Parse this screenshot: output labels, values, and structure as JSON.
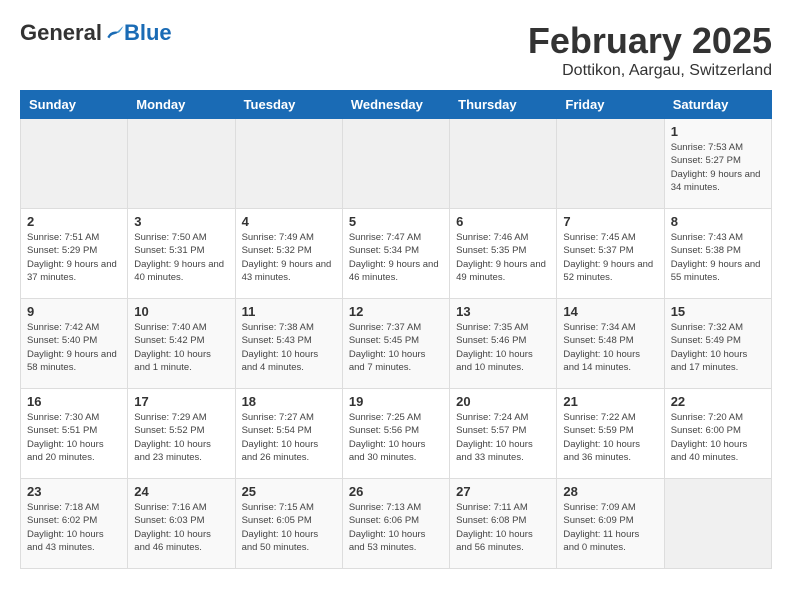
{
  "header": {
    "logo_general": "General",
    "logo_blue": "Blue",
    "month_year": "February 2025",
    "location": "Dottikon, Aargau, Switzerland"
  },
  "days_of_week": [
    "Sunday",
    "Monday",
    "Tuesday",
    "Wednesday",
    "Thursday",
    "Friday",
    "Saturday"
  ],
  "weeks": [
    [
      {
        "day": "",
        "info": ""
      },
      {
        "day": "",
        "info": ""
      },
      {
        "day": "",
        "info": ""
      },
      {
        "day": "",
        "info": ""
      },
      {
        "day": "",
        "info": ""
      },
      {
        "day": "",
        "info": ""
      },
      {
        "day": "1",
        "info": "Sunrise: 7:53 AM\nSunset: 5:27 PM\nDaylight: 9 hours and 34 minutes."
      }
    ],
    [
      {
        "day": "2",
        "info": "Sunrise: 7:51 AM\nSunset: 5:29 PM\nDaylight: 9 hours and 37 minutes."
      },
      {
        "day": "3",
        "info": "Sunrise: 7:50 AM\nSunset: 5:31 PM\nDaylight: 9 hours and 40 minutes."
      },
      {
        "day": "4",
        "info": "Sunrise: 7:49 AM\nSunset: 5:32 PM\nDaylight: 9 hours and 43 minutes."
      },
      {
        "day": "5",
        "info": "Sunrise: 7:47 AM\nSunset: 5:34 PM\nDaylight: 9 hours and 46 minutes."
      },
      {
        "day": "6",
        "info": "Sunrise: 7:46 AM\nSunset: 5:35 PM\nDaylight: 9 hours and 49 minutes."
      },
      {
        "day": "7",
        "info": "Sunrise: 7:45 AM\nSunset: 5:37 PM\nDaylight: 9 hours and 52 minutes."
      },
      {
        "day": "8",
        "info": "Sunrise: 7:43 AM\nSunset: 5:38 PM\nDaylight: 9 hours and 55 minutes."
      }
    ],
    [
      {
        "day": "9",
        "info": "Sunrise: 7:42 AM\nSunset: 5:40 PM\nDaylight: 9 hours and 58 minutes."
      },
      {
        "day": "10",
        "info": "Sunrise: 7:40 AM\nSunset: 5:42 PM\nDaylight: 10 hours and 1 minute."
      },
      {
        "day": "11",
        "info": "Sunrise: 7:38 AM\nSunset: 5:43 PM\nDaylight: 10 hours and 4 minutes."
      },
      {
        "day": "12",
        "info": "Sunrise: 7:37 AM\nSunset: 5:45 PM\nDaylight: 10 hours and 7 minutes."
      },
      {
        "day": "13",
        "info": "Sunrise: 7:35 AM\nSunset: 5:46 PM\nDaylight: 10 hours and 10 minutes."
      },
      {
        "day": "14",
        "info": "Sunrise: 7:34 AM\nSunset: 5:48 PM\nDaylight: 10 hours and 14 minutes."
      },
      {
        "day": "15",
        "info": "Sunrise: 7:32 AM\nSunset: 5:49 PM\nDaylight: 10 hours and 17 minutes."
      }
    ],
    [
      {
        "day": "16",
        "info": "Sunrise: 7:30 AM\nSunset: 5:51 PM\nDaylight: 10 hours and 20 minutes."
      },
      {
        "day": "17",
        "info": "Sunrise: 7:29 AM\nSunset: 5:52 PM\nDaylight: 10 hours and 23 minutes."
      },
      {
        "day": "18",
        "info": "Sunrise: 7:27 AM\nSunset: 5:54 PM\nDaylight: 10 hours and 26 minutes."
      },
      {
        "day": "19",
        "info": "Sunrise: 7:25 AM\nSunset: 5:56 PM\nDaylight: 10 hours and 30 minutes."
      },
      {
        "day": "20",
        "info": "Sunrise: 7:24 AM\nSunset: 5:57 PM\nDaylight: 10 hours and 33 minutes."
      },
      {
        "day": "21",
        "info": "Sunrise: 7:22 AM\nSunset: 5:59 PM\nDaylight: 10 hours and 36 minutes."
      },
      {
        "day": "22",
        "info": "Sunrise: 7:20 AM\nSunset: 6:00 PM\nDaylight: 10 hours and 40 minutes."
      }
    ],
    [
      {
        "day": "23",
        "info": "Sunrise: 7:18 AM\nSunset: 6:02 PM\nDaylight: 10 hours and 43 minutes."
      },
      {
        "day": "24",
        "info": "Sunrise: 7:16 AM\nSunset: 6:03 PM\nDaylight: 10 hours and 46 minutes."
      },
      {
        "day": "25",
        "info": "Sunrise: 7:15 AM\nSunset: 6:05 PM\nDaylight: 10 hours and 50 minutes."
      },
      {
        "day": "26",
        "info": "Sunrise: 7:13 AM\nSunset: 6:06 PM\nDaylight: 10 hours and 53 minutes."
      },
      {
        "day": "27",
        "info": "Sunrise: 7:11 AM\nSunset: 6:08 PM\nDaylight: 10 hours and 56 minutes."
      },
      {
        "day": "28",
        "info": "Sunrise: 7:09 AM\nSunset: 6:09 PM\nDaylight: 11 hours and 0 minutes."
      },
      {
        "day": "",
        "info": ""
      }
    ]
  ]
}
